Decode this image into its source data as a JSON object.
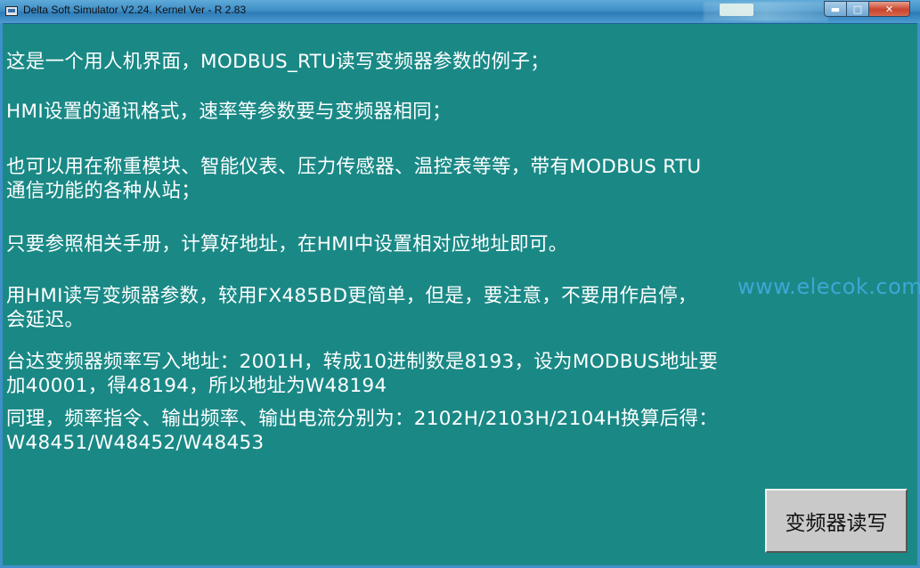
{
  "window": {
    "title": "Delta Soft Simulator V2.24. Kernel Ver - R 2.83",
    "minimize_glyph": "▬",
    "maximize_glyph": "□",
    "close_glyph": "✕"
  },
  "content": {
    "lines": [
      "这是一个用人机界面，MODBUS_RTU读写变频器参数的例子；",
      "HMI设置的通讯格式，速率等参数要与变频器相同；",
      "也可以用在称重模块、智能仪表、压力传感器、温控表等等，带有MODBUS RTU",
      "通信功能的各种从站；",
      "只要参照相关手册，计算好地址，在HMI中设置相对应地址即可。",
      "用HMI读写变频器参数，较用FX485BD更简单，但是，要注意，不要用作启停，",
      "会延迟。",
      "台达变频器频率写入地址：2001H，转成10进制数是8193，设为MODBUS地址要",
      "加40001，得48194，所以地址为W48194",
      "同理，频率指令、输出频率、输出电流分别为：2102H/2103H/2104H换算后得：",
      "W48451/W48452/W48453"
    ]
  },
  "watermark": "www.elecok.com",
  "button": {
    "label": "变频器读写"
  }
}
